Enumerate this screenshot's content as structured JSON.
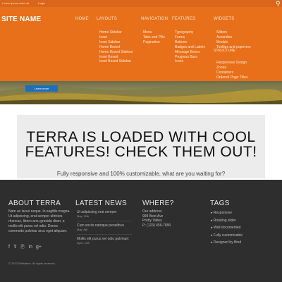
{
  "topbar": {
    "links": [
      "Lorem ipsum dolor sit",
      "Login"
    ]
  },
  "site_name": "SITE NAME",
  "nav": [
    "HOME",
    "LAYOUTS",
    "NAVIGATION",
    "FEATURES",
    "WIDGETS"
  ],
  "menus": {
    "layouts": [
      "Home Sidebar",
      "Inset",
      "Inset Sidebar",
      "Home Boxed",
      "Home Boxed Sidebar",
      "Inset Boxed",
      "Inset Boxed Sidebar"
    ],
    "navigation": [
      "Menu",
      "Tabs and Pills",
      "Pagination"
    ],
    "features": [
      "Typography",
      "Forms",
      "Buttons",
      "Badges and Labels",
      "Message Boxes",
      "Progress Bars",
      "Icons"
    ],
    "widgets": [
      "Sliders",
      "Accordion",
      "Modals",
      "Tooltips and popovers"
    ],
    "structure_heading": "STRUCTURE",
    "structure": [
      "Responsive Design",
      "Zones",
      "Containers",
      "Ordered Page Titles"
    ]
  },
  "hero": {
    "button_label": "Learn more"
  },
  "feature": {
    "heading": "TERRA IS LOADED WITH COOL FEATURES! CHECK THEM OUT!",
    "subtext": "Fully responsive and 100% customizable, what are you waiting for?"
  },
  "footer": {
    "about": {
      "title": "ABOUT TERRA",
      "text": "Nam ac lacus neque. In sagittis magna. Ut adipiscing, erat semper ultricies rhoncus, libero arcu gravida diam, a mollis elit purus vel odio. Donec commodo pulvinar arcu eget aliquam."
    },
    "news": {
      "title": "LATEST NEWS",
      "items": [
        {
          "title": "Ut adipiscing erat semper",
          "date": "May, 20th"
        },
        {
          "title": "Cum sociis natoque penatibus",
          "date": "May, 8th"
        },
        {
          "title": "Mollis elit purus vel odio pulvinart",
          "date": "April, 12th"
        }
      ]
    },
    "where": {
      "title": "WHERE?",
      "lines": [
        "Our address",
        "999 Best Ave",
        "Pretty Valley",
        "P: (123) 456-7890"
      ]
    },
    "tags": {
      "title": "TAGS",
      "items": [
        "Responsive",
        "Rotating slider",
        "Well documented",
        "Fully customizable",
        "Designed by Bind"
      ]
    },
    "social_icons": [
      "facebook-icon",
      "twitter-icon",
      "pinterest-icon",
      "linkedin-icon",
      "googleplus-icon"
    ],
    "copyright": "© 2013 SiteName. All rights reserved."
  },
  "colors": {
    "header": "#e8701a",
    "footer": "#2e2e2e",
    "button": "#1f6fb8",
    "feature_bg": "#ececec"
  }
}
